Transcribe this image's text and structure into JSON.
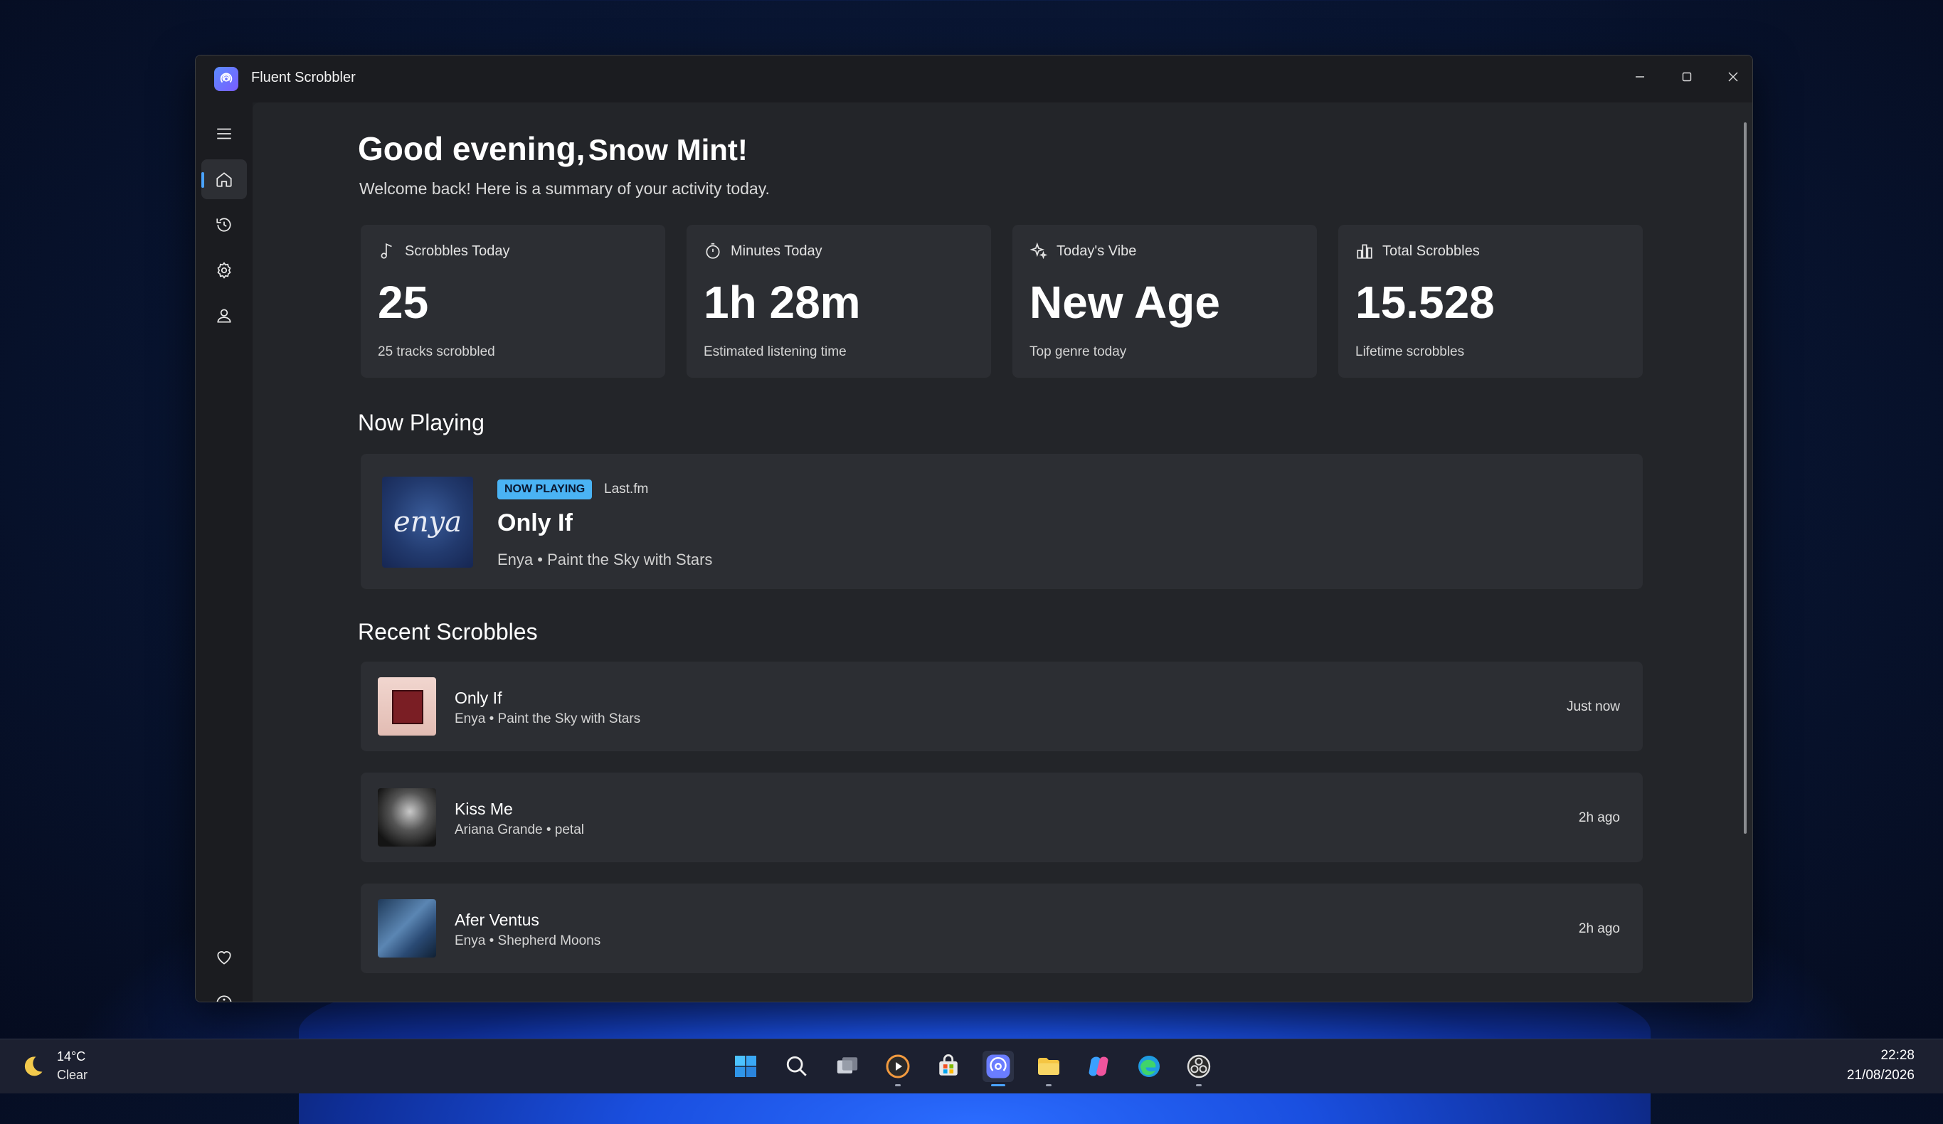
{
  "window": {
    "title": "Fluent Scrobbler"
  },
  "nav": {
    "items": [
      {
        "name": "menu"
      },
      {
        "name": "home",
        "active": true
      },
      {
        "name": "history"
      },
      {
        "name": "settings"
      },
      {
        "name": "profile"
      },
      {
        "name": "favorites"
      },
      {
        "name": "about"
      }
    ]
  },
  "greeting": {
    "prefix": "Good evening,",
    "name": "Snow Mint!",
    "subtitle": "Welcome back! Here is a summary of your activity today."
  },
  "stats": [
    {
      "label": "Scrobbles Today",
      "value": "25",
      "caption": "25 tracks scrobbled",
      "icon": "music-note-icon"
    },
    {
      "label": "Minutes Today",
      "value": "1h 28m",
      "caption": "Estimated listening time",
      "icon": "timer-icon"
    },
    {
      "label": "Today's Vibe",
      "value": "New Age",
      "caption": "Top genre today",
      "icon": "sparkle-icon"
    },
    {
      "label": "Total Scrobbles",
      "value": "15.528",
      "caption": "Lifetime scrobbles",
      "icon": "bar-chart-icon"
    }
  ],
  "now_playing": {
    "section_title": "Now Playing",
    "badge": "NOW PLAYING",
    "source": "Last.fm",
    "title": "Only If",
    "subtitle": "Enya • Paint the Sky with Stars",
    "art_text": "enya"
  },
  "recent": {
    "section_title": "Recent Scrobbles",
    "items": [
      {
        "title": "Only If",
        "subtitle": "Enya • Paint the Sky with Stars",
        "time": "Just now"
      },
      {
        "title": "Kiss Me",
        "subtitle": "Ariana Grande • petal",
        "time": "2h ago"
      },
      {
        "title": "Afer Ventus",
        "subtitle": "Enya • Shepherd Moons",
        "time": "2h ago"
      }
    ]
  },
  "taskbar": {
    "weather_temp": "14°C",
    "weather_condition": "Clear",
    "time": "22:28",
    "date": "21/08/2026"
  },
  "colors": {
    "accent": "#4aa3ff",
    "badge": "#4ab3f4",
    "card": "#2c2e33",
    "surface": "#232529"
  }
}
